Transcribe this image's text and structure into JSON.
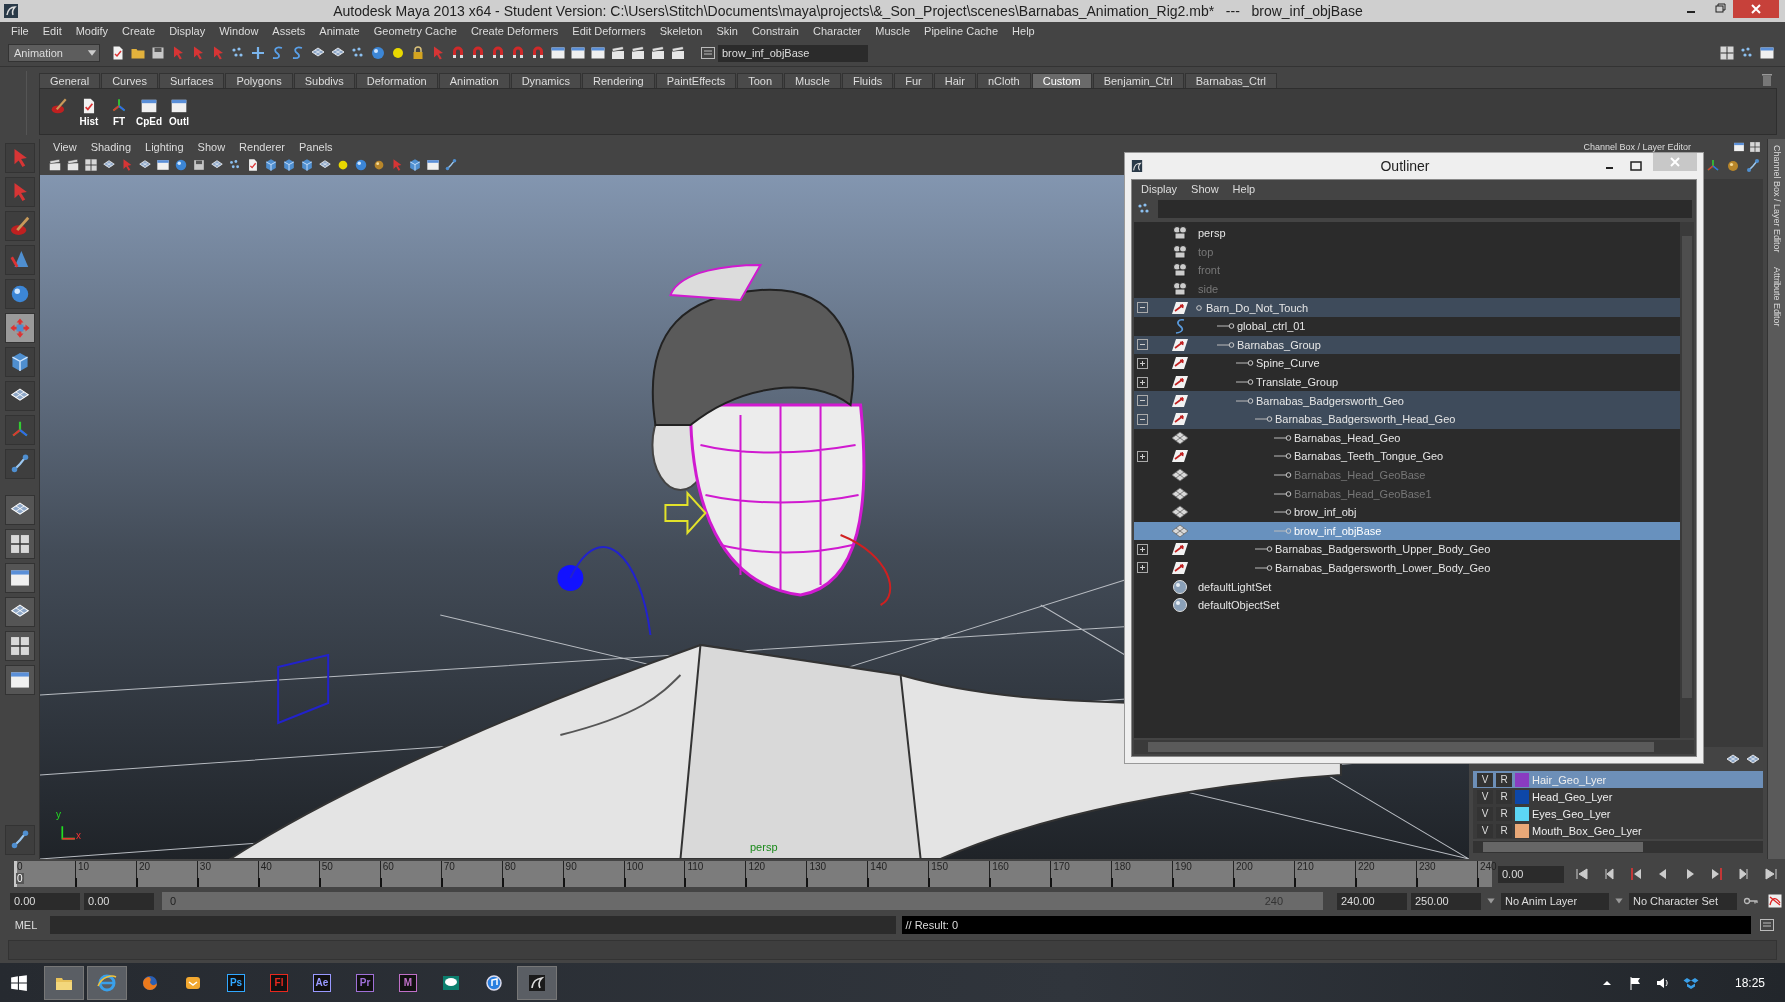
{
  "window": {
    "title": "Autodesk Maya 2013 x64 - Student Version: C:\\Users\\Stitch\\Documents\\maya\\projects\\&_Son_Project\\scenes\\Barnabas_Animation_Rig2.mb*   ---   brow_inf_objBase"
  },
  "menu": [
    "File",
    "Edit",
    "Modify",
    "Create",
    "Display",
    "Window",
    "Assets",
    "Animate",
    "Geometry Cache",
    "Create Deformers",
    "Edit Deformers",
    "Skeleton",
    "Skin",
    "Constrain",
    "Character",
    "Muscle",
    "Pipeline Cache",
    "Help"
  ],
  "status_line": {
    "menu_set": "Animation",
    "name_field": "brow_inf_objBase"
  },
  "shelf": {
    "tabs": [
      {
        "label": "General",
        "selected": false
      },
      {
        "label": "Curves",
        "selected": false
      },
      {
        "label": "Surfaces",
        "selected": false
      },
      {
        "label": "Polygons",
        "selected": false
      },
      {
        "label": "Subdivs",
        "selected": false
      },
      {
        "label": "Deformation",
        "selected": false
      },
      {
        "label": "Animation",
        "selected": false
      },
      {
        "label": "Dynamics",
        "selected": false
      },
      {
        "label": "Rendering",
        "selected": false
      },
      {
        "label": "PaintEffects",
        "selected": false
      },
      {
        "label": "Toon",
        "selected": false
      },
      {
        "label": "Muscle",
        "selected": false
      },
      {
        "label": "Fluids",
        "selected": false
      },
      {
        "label": "Fur",
        "selected": false
      },
      {
        "label": "Hair",
        "selected": false
      },
      {
        "label": "nCloth",
        "selected": false
      },
      {
        "label": "Custom",
        "selected": true
      },
      {
        "label": "Benjamin_Ctrl",
        "selected": false
      },
      {
        "label": "Barnabas_Ctrl",
        "selected": false
      }
    ],
    "buttons": [
      {
        "kind": "paint"
      },
      {
        "kind": "document",
        "label": "Hist"
      },
      {
        "kind": "axis",
        "label": "FT"
      },
      {
        "kind": "window",
        "label": "CpEd"
      },
      {
        "kind": "window",
        "label": "Outl"
      }
    ]
  },
  "panel_menu": [
    "View",
    "Shading",
    "Lighting",
    "Show",
    "Renderer",
    "Panels"
  ],
  "viewport": {
    "camera": "persp",
    "axis_labels": [
      "y",
      "x"
    ]
  },
  "channel_box": {
    "title": "Channel Box / Layer Editor"
  },
  "side_tabs": [
    "Channel Box / Layer Editor",
    "Attribute Editor"
  ],
  "layers": [
    {
      "visible": "V",
      "reference": "R",
      "name": "Hair_Geo_Lyer",
      "color": "#8a3cc0",
      "selected": true
    },
    {
      "visible": "V",
      "reference": "R",
      "name": "Head_Geo_Lyer",
      "color": "#0d47a8",
      "selected": false
    },
    {
      "visible": "V",
      "reference": "R",
      "name": "Eyes_Geo_Lyer",
      "color": "#5cd6f5",
      "selected": false
    },
    {
      "visible": "V",
      "reference": "R",
      "name": "Mouth_Box_Geo_Lyer",
      "color": "#e8a878",
      "selected": false
    }
  ],
  "outliner": {
    "title": "Outliner",
    "menu": [
      "Display",
      "Show",
      "Help"
    ],
    "items": [
      {
        "label": "persp",
        "kind": "camera",
        "selected": false,
        "highlighted": false,
        "dimmed": false
      },
      {
        "label": "top",
        "kind": "camera",
        "selected": false,
        "highlighted": false,
        "dimmed": true
      },
      {
        "label": "front",
        "kind": "camera",
        "selected": false,
        "highlighted": false,
        "dimmed": true
      },
      {
        "label": "side",
        "kind": "camera",
        "selected": false,
        "highlighted": false,
        "dimmed": true
      },
      {
        "label": "Barn_Do_Not_Touch",
        "kind": "transform",
        "selected": false,
        "highlighted": true,
        "dimmed": false,
        "expanded": true,
        "children": [
          {
            "label": "global_ctrl_01",
            "kind": "curve",
            "selected": false,
            "highlighted": false,
            "dimmed": false
          },
          {
            "label": "Barnabas_Group",
            "kind": "transform",
            "selected": false,
            "highlighted": true,
            "dimmed": false,
            "expanded": true,
            "children": [
              {
                "label": "Spine_Curve",
                "kind": "transform",
                "selected": false,
                "highlighted": false,
                "dimmed": false,
                "expanded": false
              },
              {
                "label": "Translate_Group",
                "kind": "transform",
                "selected": false,
                "highlighted": false,
                "dimmed": false,
                "expanded": false
              },
              {
                "label": "Barnabas_Badgersworth_Geo",
                "kind": "transform",
                "selected": false,
                "highlighted": true,
                "dimmed": false,
                "expanded": true,
                "children": [
                  {
                    "label": "Barnabas_Badgersworth_Head_Geo",
                    "kind": "transform",
                    "selected": false,
                    "highlighted": true,
                    "dimmed": false,
                    "expanded": true,
                    "children": [
                      {
                        "label": "Barnabas_Head_Geo",
                        "kind": "mesh",
                        "selected": false,
                        "highlighted": false,
                        "dimmed": false
                      },
                      {
                        "label": "Barnabas_Teeth_Tongue_Geo",
                        "kind": "transform",
                        "selected": false,
                        "highlighted": false,
                        "dimmed": false,
                        "expanded": false
                      },
                      {
                        "label": "Barnabas_Head_GeoBase",
                        "kind": "mesh",
                        "selected": false,
                        "highlighted": false,
                        "dimmed": true
                      },
                      {
                        "label": "Barnabas_Head_GeoBase1",
                        "kind": "mesh",
                        "selected": false,
                        "highlighted": false,
                        "dimmed": true
                      },
                      {
                        "label": "brow_inf_obj",
                        "kind": "mesh",
                        "selected": false,
                        "highlighted": false,
                        "dimmed": false
                      },
                      {
                        "label": "brow_inf_objBase",
                        "kind": "mesh",
                        "selected": true,
                        "highlighted": false,
                        "dimmed": false
                      }
                    ]
                  },
                  {
                    "label": "Barnabas_Badgersworth_Upper_Body_Geo",
                    "kind": "transform",
                    "selected": false,
                    "highlighted": false,
                    "dimmed": false,
                    "expanded": false
                  },
                  {
                    "label": "Barnabas_Badgersworth_Lower_Body_Geo",
                    "kind": "transform",
                    "selected": false,
                    "highlighted": false,
                    "dimmed": false,
                    "expanded": false
                  }
                ]
              }
            ]
          }
        ]
      },
      {
        "label": "defaultLightSet",
        "kind": "set",
        "selected": false,
        "highlighted": false,
        "dimmed": false
      },
      {
        "label": "defaultObjectSet",
        "kind": "set",
        "selected": false,
        "highlighted": false,
        "dimmed": false
      }
    ]
  },
  "timeline": {
    "ticks": [
      "0",
      "10",
      "20",
      "30",
      "40",
      "50",
      "60",
      "70",
      "80",
      "90",
      "100",
      "110",
      "120",
      "130",
      "140",
      "150",
      "160",
      "170",
      "180",
      "190",
      "200",
      "210",
      "220",
      "230",
      "240"
    ],
    "current_frame": "0",
    "level": 0,
    "time_field": "0.00"
  },
  "range": {
    "start_time": "0.00",
    "playback_start": "0.00",
    "slider_start": "0",
    "slider_end": "240",
    "playback_end": "240.00",
    "end_time": "250.00",
    "anim_layer": "No Anim Layer",
    "character_set": "No Character Set"
  },
  "command_line": {
    "language": "MEL",
    "result": "// Result: 0"
  },
  "taskbar": {
    "apps": [
      {
        "kind": "explorer",
        "active": true
      },
      {
        "kind": "browser",
        "active": true
      },
      {
        "kind": "firefox",
        "active": false
      },
      {
        "kind": "mail",
        "active": false
      },
      {
        "kind": "letter",
        "label": "Ps",
        "color": "#31a8ff",
        "active": false
      },
      {
        "kind": "letter",
        "label": "Fl",
        "color": "#e8281e",
        "active": false
      },
      {
        "kind": "letter",
        "label": "Ae",
        "color": "#9999ff",
        "active": false
      },
      {
        "kind": "letter",
        "label": "Pr",
        "color": "#a070d8",
        "active": false
      },
      {
        "kind": "letter",
        "label": "M",
        "color": "#c070c8",
        "active": false
      },
      {
        "kind": "chat",
        "active": false
      },
      {
        "kind": "music",
        "active": false
      },
      {
        "kind": "maya",
        "active": true
      }
    ],
    "time": "18:25"
  }
}
